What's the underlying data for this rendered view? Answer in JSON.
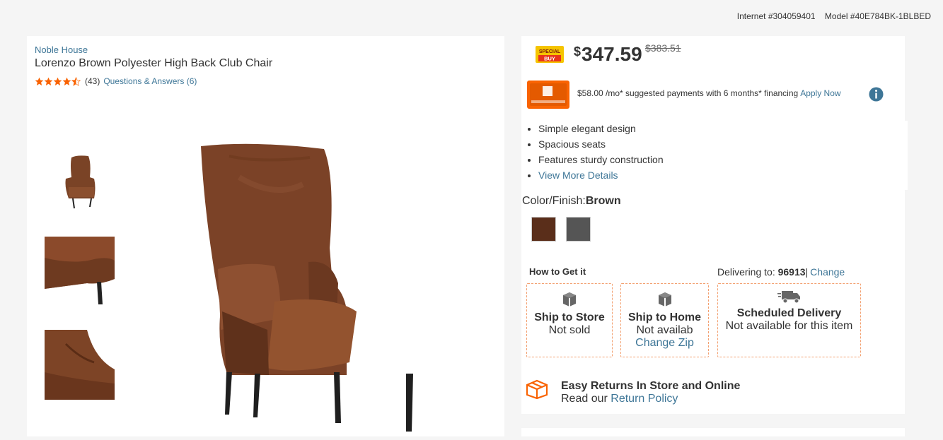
{
  "header": {
    "internet_id": "Internet #304059401",
    "model_id": "Model #40E784BK-1BLBED"
  },
  "product": {
    "brand": "Noble House",
    "title": "Lorenzo Brown Polyester High Back Club Chair",
    "rating": 4.5,
    "review_count": "(43)",
    "qa_link": "Questions & Answers (6)"
  },
  "images": {
    "main_alt": "Brown high back club chair",
    "thumbs": [
      "thumb-1",
      "thumb-2",
      "thumb-3"
    ]
  },
  "pricing": {
    "badge_line1": "SPECIAL",
    "badge_line2": "BUY",
    "currency": "$",
    "price": "347.59",
    "was_price": "$383.51",
    "financing_text": "$58.00 /mo* suggested payments with 6 months* financing",
    "apply_now": "Apply Now"
  },
  "highlights": {
    "items": [
      "Simple elegant design",
      "Spacious seats",
      "Features sturdy construction"
    ],
    "more_link": "View More Details"
  },
  "color": {
    "label": "Color/Finish:",
    "selected": "Brown",
    "swatches": [
      "#5a2e1a",
      "#555555"
    ]
  },
  "fulfillment": {
    "heading": "How to Get it",
    "delivering_to_label": "Delivering to:",
    "zip": "96913",
    "separator": "|",
    "change": "Change",
    "options": [
      {
        "title": "Ship to Store",
        "sub": "Not sold"
      },
      {
        "title": "Ship to Home",
        "sub": "Not availab",
        "link": "Change Zip"
      },
      {
        "title": "Scheduled Delivery",
        "sub": "Not available for this item"
      }
    ]
  },
  "returns": {
    "title": "Easy Returns In Store and Online",
    "prefix": "Read our",
    "link": "Return Policy"
  },
  "colors": {
    "link": "#3e7697",
    "orange": "#f96302",
    "dashed": "#f3a070"
  }
}
